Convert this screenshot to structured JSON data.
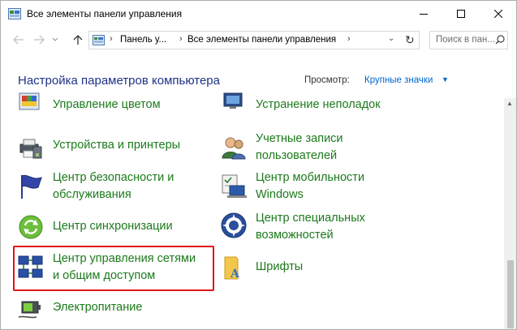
{
  "window": {
    "title": "Все элементы панели управления"
  },
  "address_bar": {
    "crumbs": [
      "Панель у...",
      "Все элементы панели управления"
    ],
    "search_placeholder": "Поиск в пан..."
  },
  "header": {
    "heading": "Настройка параметров компьютера",
    "view_label": "Просмотр:",
    "view_value": "Крупные значки"
  },
  "items": [
    {
      "label_lines": [
        "Управление цветом"
      ],
      "icon": "color-management-icon"
    },
    {
      "label_lines": [
        "Устранение неполадок"
      ],
      "icon": "troubleshooting-icon"
    },
    {
      "label_lines": [
        "Устройства и принтеры"
      ],
      "icon": "devices-printers-icon"
    },
    {
      "label_lines": [
        "Учетные записи",
        "пользователей"
      ],
      "icon": "user-accounts-icon"
    },
    {
      "label_lines": [
        "Центр безопасности и",
        "обслуживания"
      ],
      "icon": "security-maintenance-flag-icon"
    },
    {
      "label_lines": [
        "Центр мобильности",
        "Windows"
      ],
      "icon": "mobility-center-icon"
    },
    {
      "label_lines": [
        "Центр синхронизации"
      ],
      "icon": "sync-center-icon"
    },
    {
      "label_lines": [
        "Центр специальных",
        "возможностей"
      ],
      "icon": "ease-of-access-icon"
    },
    {
      "label_lines": [
        "Центр управления сетями",
        "и общим доступом"
      ],
      "icon": "network-sharing-icon"
    },
    {
      "label_lines": [
        "Шрифты"
      ],
      "icon": "fonts-folder-icon"
    },
    {
      "label_lines": [
        "Электропитание"
      ],
      "icon": "power-options-icon"
    }
  ],
  "colors": {
    "link_green": "#1b7a1b",
    "heading_blue": "#1e3287",
    "highlight_red": "#e0141e",
    "view_blue": "#0066cc"
  }
}
